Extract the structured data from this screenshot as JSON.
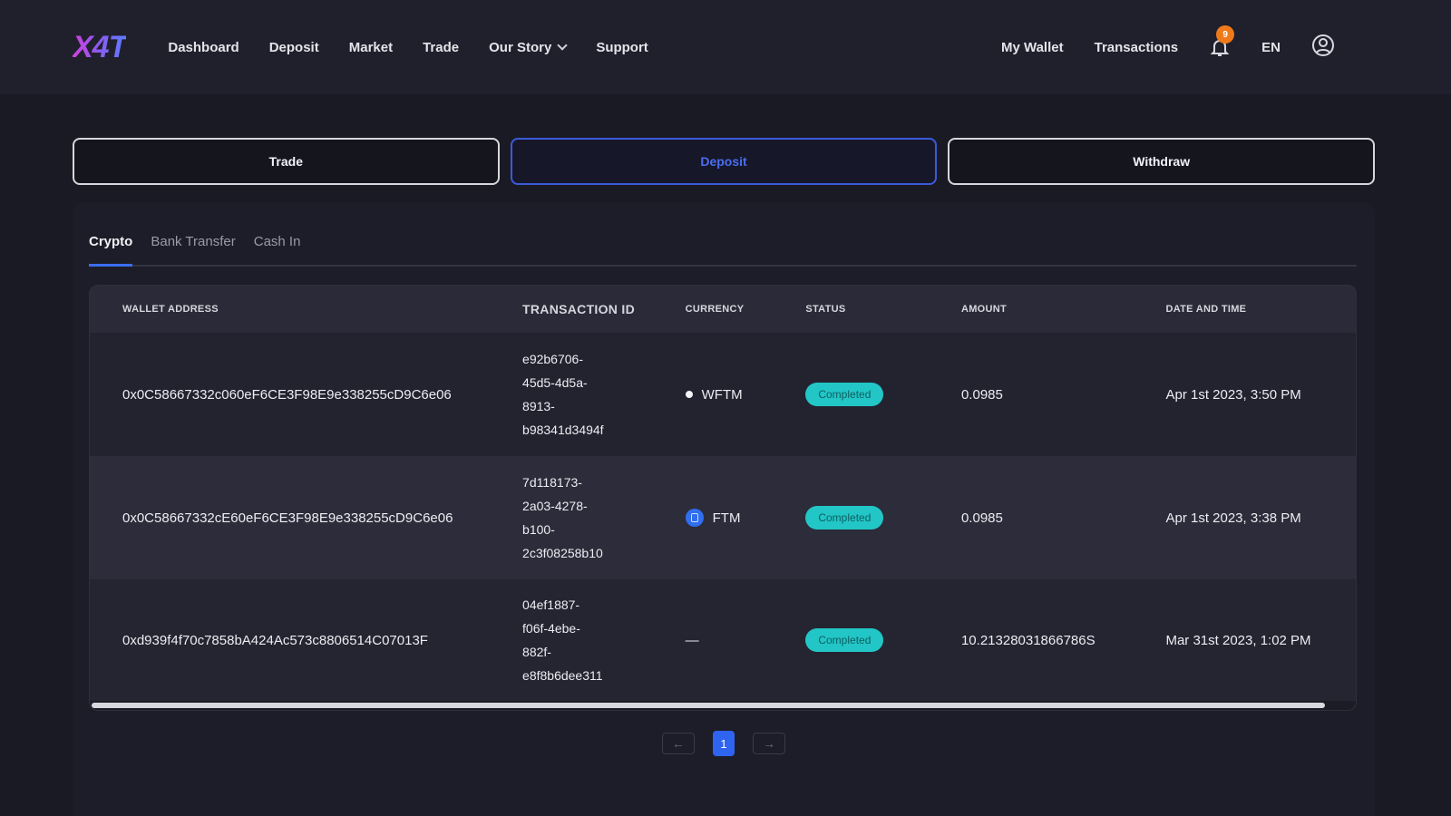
{
  "header": {
    "logo": "X4T",
    "nav": [
      "Dashboard",
      "Deposit",
      "Market",
      "Trade",
      "Our Story",
      "Support"
    ],
    "right": {
      "wallet": "My Wallet",
      "transactions": "Transactions",
      "notification_count": "9",
      "language": "EN"
    }
  },
  "actions": {
    "trade": "Trade",
    "deposit": "Deposit",
    "withdraw": "Withdraw"
  },
  "tabs": [
    "Crypto",
    "Bank Transfer",
    "Cash In"
  ],
  "table": {
    "columns": [
      "WALLET ADDRESS",
      "TRANSACTION ID",
      "CURRENCY",
      "STATUS",
      "AMOUNT",
      "DATE AND TIME"
    ],
    "rows": [
      {
        "address": "0x0C58667332c060eF6CE3F98E9e338255cD9C6e06",
        "tx": [
          "e92b6706-",
          "45d5-4d5a-",
          "8913-",
          "b98341d3494f"
        ],
        "currency": "WFTM",
        "currency_icon": "white-dot-icon",
        "status": "Completed",
        "amount": "0.0985",
        "date": "Apr 1st 2023, 3:50 PM"
      },
      {
        "address": "0x0C58667332cE60eF6CE3F98E9e338255cD9C6e06",
        "tx": [
          "7d118173-",
          "2a03-4278-",
          "b100-",
          "2c3f08258b10"
        ],
        "currency": "FTM",
        "currency_icon": "fantom-icon",
        "status": "Completed",
        "amount": "0.0985",
        "date": "Apr 1st 2023, 3:38 PM"
      },
      {
        "address": "0xd939f4f70c7858bA424Ac573c8806514C07013F",
        "tx": [
          "04ef1887-",
          "f06f-4ebe-",
          "882f-",
          "e8f8b6dee311"
        ],
        "currency": "—",
        "currency_icon": "",
        "status": "Completed",
        "amount": "10.21328031866786S",
        "date": "Mar 31st 2023, 1:02 PM"
      }
    ]
  },
  "pagination": {
    "prev": "←",
    "page": "1",
    "next": "→"
  },
  "colors": {
    "accent": "#3a6ef0",
    "status": "#22c6c6",
    "badge": "#f07a1a"
  }
}
